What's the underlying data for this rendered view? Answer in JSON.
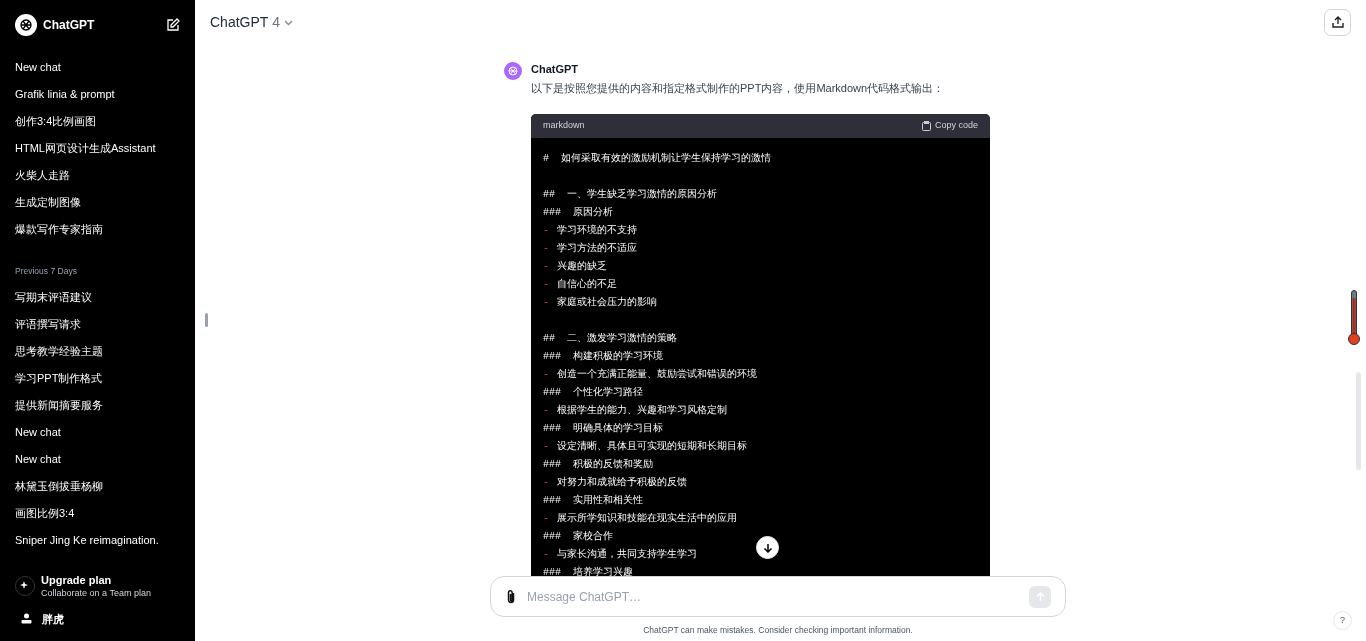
{
  "sidebar": {
    "brand": "ChatGPT",
    "groups": [
      {
        "items": [
          "New chat",
          "Grafik linia & prompt",
          "创作3:4比例画图",
          "HTML网页设计生成Assistant",
          "火柴人走路",
          "生成定制图像",
          "爆款写作专家指南"
        ]
      },
      {
        "heading": "Previous 7 Days",
        "items": [
          "写期末评语建议",
          "评语撰写请求",
          "思考教学经验主题",
          "学习PPT制作格式",
          "提供新闻摘要服务",
          "New chat",
          "New chat",
          "林黛玉倒拔垂杨柳",
          "画图比例3:4",
          "Sniper Jing Ke reimagination."
        ]
      }
    ],
    "upgrade": {
      "title": "Upgrade plan",
      "subtitle": "Collaborate on a Team plan"
    },
    "user": {
      "name": "胖虎"
    }
  },
  "header": {
    "model": "ChatGPT",
    "version": "4"
  },
  "message": {
    "author": "ChatGPT",
    "text": "以下是按照您提供的内容和指定格式制作的PPT内容，使用Markdown代码格式输出：",
    "code": {
      "language": "markdown",
      "copy_label": "Copy code",
      "lines": [
        {
          "kind": "heading",
          "text": "#  如何采取有效的激励机制让学生保持学习的激情"
        },
        {
          "kind": "blank"
        },
        {
          "kind": "heading",
          "text": "##  一、学生缺乏学习激情的原因分析"
        },
        {
          "kind": "heading",
          "text": "###  原因分析"
        },
        {
          "kind": "bullet",
          "marker": "-",
          "text": "学习环境的不支持"
        },
        {
          "kind": "bullet",
          "marker": "-",
          "text": "学习方法的不适应"
        },
        {
          "kind": "bullet",
          "marker": "-",
          "text": "兴趣的缺乏"
        },
        {
          "kind": "bullet",
          "marker": "-",
          "text": "自信心的不足"
        },
        {
          "kind": "bullet",
          "marker": "-",
          "text": "家庭或社会压力的影响"
        },
        {
          "kind": "blank"
        },
        {
          "kind": "heading",
          "text": "##  二、激发学习激情的策略"
        },
        {
          "kind": "heading",
          "text": "###  构建积极的学习环境"
        },
        {
          "kind": "bullet",
          "marker": "-",
          "text": "创造一个充满正能量、鼓励尝试和错误的环境"
        },
        {
          "kind": "heading",
          "text": "###  个性化学习路径"
        },
        {
          "kind": "bullet",
          "marker": "-",
          "text": "根据学生的能力、兴趣和学习风格定制"
        },
        {
          "kind": "heading",
          "text": "###  明确具体的学习目标"
        },
        {
          "kind": "bullet",
          "marker": "-",
          "text": "设定清晰、具体且可实现的短期和长期目标"
        },
        {
          "kind": "heading",
          "text": "###  积极的反馈和奖励"
        },
        {
          "kind": "bullet",
          "marker": "-",
          "text": "对努力和成就给予积极的反馈"
        },
        {
          "kind": "heading",
          "text": "###  实用性和相关性"
        },
        {
          "kind": "bullet",
          "marker": "-",
          "text": "展示所学知识和技能在现实生活中的应用"
        },
        {
          "kind": "heading",
          "text": "###  家校合作"
        },
        {
          "kind": "bullet",
          "marker": "-",
          "text": "与家长沟通，共同支持学生学习"
        },
        {
          "kind": "heading",
          "text": "###  培养学习兴趣"
        }
      ]
    }
  },
  "composer": {
    "placeholder": "Message ChatGPT…"
  },
  "disclaimer": "ChatGPT can make mistakes. Consider checking important information.",
  "help": "?"
}
